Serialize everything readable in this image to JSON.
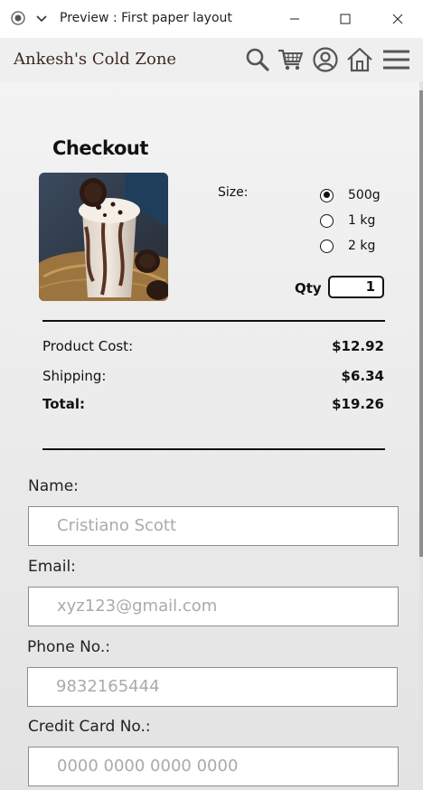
{
  "window": {
    "title": "Preview : First paper layout"
  },
  "header": {
    "brand": "Ankesh's Cold Zone",
    "icons": [
      "search-icon",
      "cart-icon",
      "user-icon",
      "home-icon",
      "menu-icon"
    ]
  },
  "checkout": {
    "title": "Checkout",
    "size_label": "Size:",
    "sizes": [
      {
        "label": "500g",
        "selected": true
      },
      {
        "label": "1 kg",
        "selected": false
      },
      {
        "label": "2 kg",
        "selected": false
      }
    ],
    "qty_label": "Qty",
    "qty_value": "1"
  },
  "costs": {
    "product_label": "Product Cost:",
    "product_value": "$12.92",
    "shipping_label": "Shipping:",
    "shipping_value": "$6.34",
    "total_label": "Total:",
    "total_value": "$19.26"
  },
  "form": {
    "name_label": "Name:",
    "name_placeholder": "Cristiano Scott",
    "email_label": "Email:",
    "email_placeholder": "xyz123@gmail.com",
    "phone_label": "Phone No.:",
    "phone_placeholder": "9832165444",
    "card_label": "Credit Card No.:",
    "card_placeholder": "0000 0000 0000 0000"
  }
}
